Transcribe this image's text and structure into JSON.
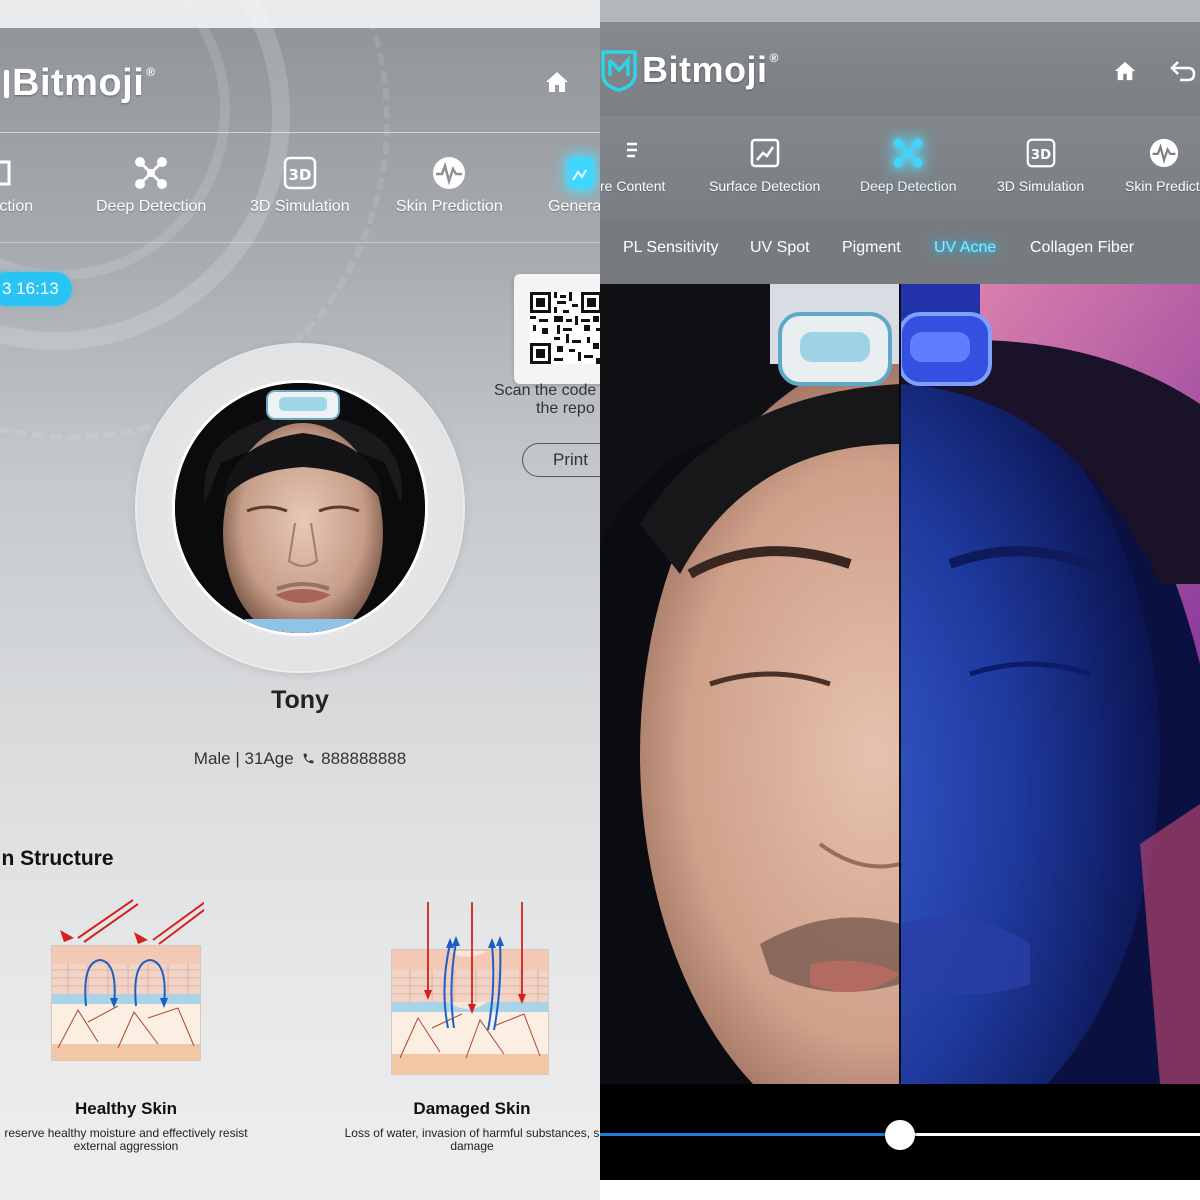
{
  "left": {
    "brand": "Bitmoji",
    "brand_mark": "®",
    "nav": [
      {
        "label": "tection",
        "icon": "surface-detection-icon"
      },
      {
        "label": "Deep Detection",
        "icon": "deep-detection-icon"
      },
      {
        "label": "3D Simulation",
        "icon": "3d-simulation-icon"
      },
      {
        "label": "Skin Prediction",
        "icon": "skin-prediction-icon"
      },
      {
        "label": "General",
        "icon": "general-report-icon"
      }
    ],
    "time": "3 16:13",
    "qr": {
      "scan_line1": "Scan the code",
      "scan_line2": "the repo",
      "print_label": "Print"
    },
    "profile": {
      "name": "Tony",
      "info": "Male | 31Age",
      "phone": "888888888"
    },
    "section_title": "kin Structure",
    "skin": [
      {
        "title": "Healthy Skin",
        "desc1": "reserve healthy moisture and effectively resist",
        "desc2": "external aggression"
      },
      {
        "title": "Damaged Skin",
        "desc1": "Loss of water, invasion of harmful substances, s",
        "desc2": "damage"
      }
    ]
  },
  "right": {
    "brand": "Bitmoji",
    "brand_mark": "®",
    "nav": [
      {
        "label": "re Content",
        "icon": "texture-content-icon"
      },
      {
        "label": "Surface Detection",
        "icon": "surface-detection-icon"
      },
      {
        "label": "Deep Detection",
        "icon": "deep-detection-icon",
        "active": true
      },
      {
        "label": "3D Simulation",
        "icon": "3d-simulation-icon"
      },
      {
        "label": "Skin Predicti",
        "icon": "skin-prediction-icon"
      }
    ],
    "sub_tabs": [
      "PL Sensitivity",
      "UV Spot",
      "Pigment",
      "UV Acne",
      "Collagen Fiber"
    ],
    "active_sub_tab": "UV Acne",
    "comparison_slider": 0.5
  },
  "colors": {
    "accent": "#28c4f4",
    "glow": "#1ec6ff",
    "slider_fill": "#1e7fd8"
  }
}
